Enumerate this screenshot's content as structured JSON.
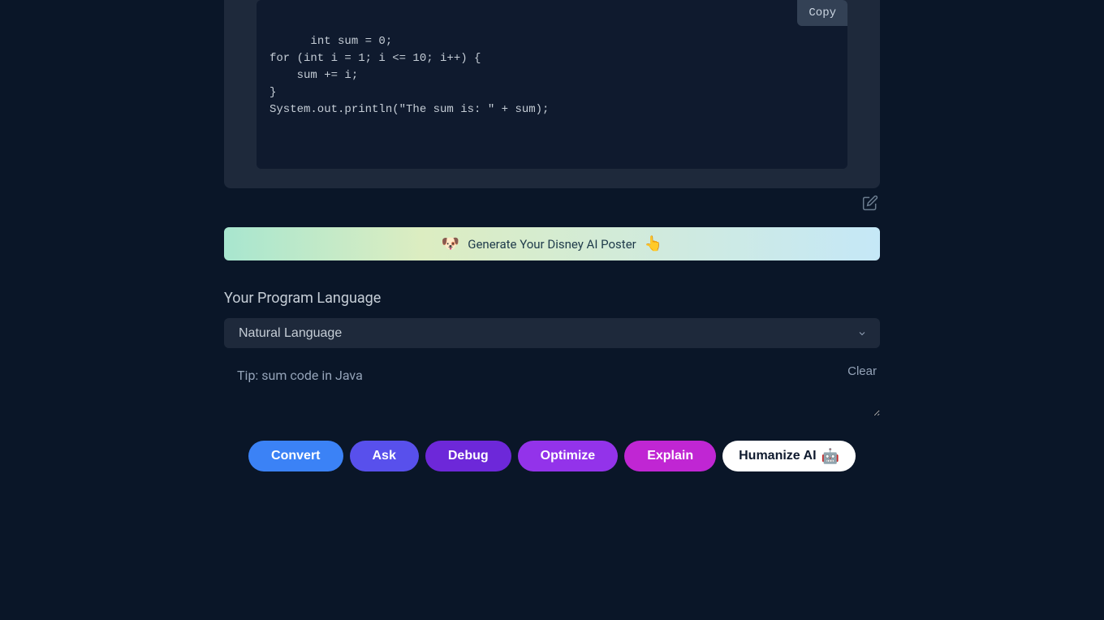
{
  "response": {
    "code": "int sum = 0;\nfor (int i = 1; i <= 10; i++) {\n    sum += i;\n}\nSystem.out.println(\"The sum is: \" + sum);",
    "copy_label": "Copy"
  },
  "banner": {
    "emoji_left": "🐶",
    "text": "Generate Your Disney AI Poster",
    "emoji_right": "👆"
  },
  "language_section": {
    "label": "Your Program Language",
    "selected": "Natural Language"
  },
  "input": {
    "placeholder": "Tip: sum code in Java",
    "clear_label": "Clear"
  },
  "buttons": {
    "convert": "Convert",
    "ask": "Ask",
    "debug": "Debug",
    "optimize": "Optimize",
    "explain": "Explain",
    "humanize": "Humanize AI",
    "humanize_emoji": "🤖"
  }
}
